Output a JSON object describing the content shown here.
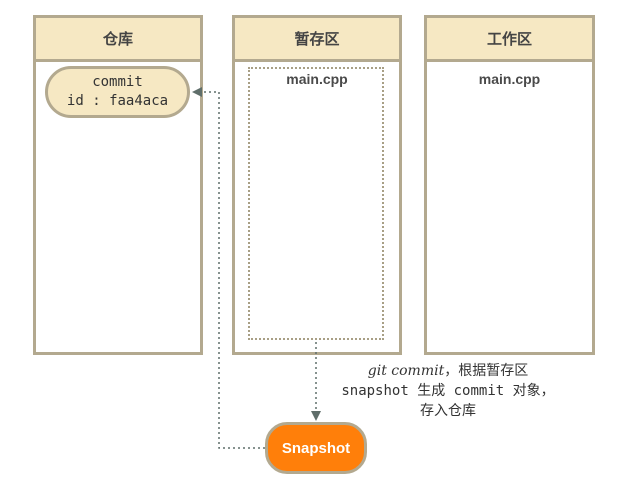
{
  "columns": {
    "repository": "仓库",
    "staging": "暂存区",
    "working": "工作区"
  },
  "commit": {
    "line1": "commit",
    "line2": "id : faa4aca"
  },
  "staging_file": "main.cpp",
  "working_file": "main.cpp",
  "snapshot_label": "Snapshot",
  "annotation": {
    "command": "git commit",
    "rest_line1": "，根据暂存区",
    "line2": "snapshot 生成 commit 对象，",
    "line3": "存入仓库"
  },
  "colors": {
    "header_fill": "#f6e8c3",
    "border": "#b3a98f",
    "snapshot_fill": "#ff7f0a",
    "arrow": "#5f6e6a"
  }
}
